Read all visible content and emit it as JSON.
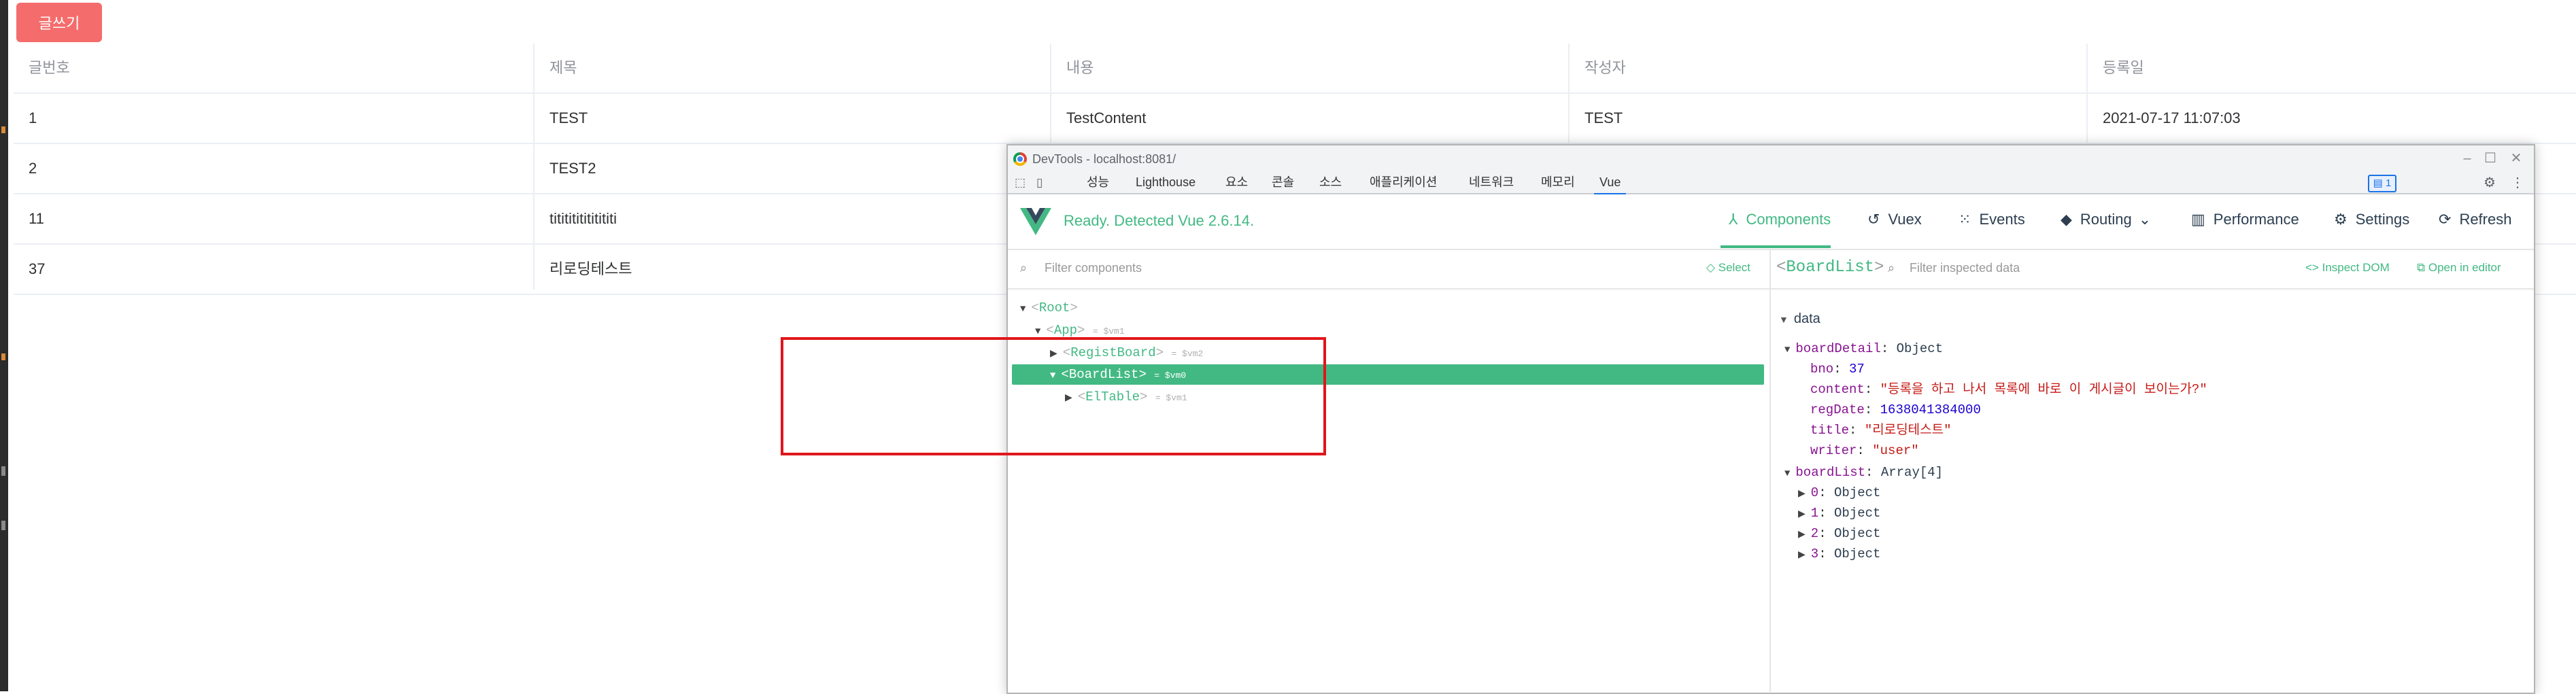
{
  "page": {
    "write_button": "글쓰기",
    "table": {
      "headers": [
        "글번호",
        "제목",
        "내용",
        "작성자",
        "등록일"
      ],
      "rows": [
        [
          "1",
          "TEST",
          "TestContent",
          "TEST",
          "2021-07-17 11:07:03"
        ],
        [
          "2",
          "TEST2",
          "",
          "",
          ""
        ],
        [
          "11",
          "tititititititititi",
          "",
          "",
          ""
        ],
        [
          "37",
          "리로딩테스트",
          "",
          "",
          ""
        ]
      ]
    }
  },
  "devtools": {
    "window_title": "DevTools - localhost:8081/",
    "tabs": [
      "성능",
      "Lighthouse",
      "요소",
      "콘솔",
      "소스",
      "애플리케이션",
      "네트워크",
      "메모리",
      "Vue"
    ],
    "active_tab": "Vue",
    "issues_badge": "1",
    "vue": {
      "status": "Ready. Detected Vue 2.6.14.",
      "nav": {
        "components": "Components",
        "vuex": "Vuex",
        "events": "Events",
        "routing": "Routing",
        "performance": "Performance",
        "settings": "Settings",
        "refresh": "Refresh"
      },
      "filter_components_placeholder": "Filter components",
      "select_label": "Select",
      "tree": [
        {
          "name": "Root",
          "vm": ""
        },
        {
          "name": "App",
          "vm": "= $vm1"
        },
        {
          "name": "RegistBoard",
          "vm": "= $vm2"
        },
        {
          "name": "BoardList",
          "vm": "= $vm0"
        },
        {
          "name": "ElTable",
          "vm": "= $vm1"
        }
      ],
      "inspector": {
        "component": "BoardList",
        "filter_placeholder": "Filter inspected data",
        "inspect_dom": "Inspect DOM",
        "open_in_editor": "Open in editor",
        "section": "data",
        "boardDetail": {
          "key": "boardDetail",
          "type": "Object",
          "fields": [
            {
              "key": "bno",
              "value": "37",
              "kind": "num"
            },
            {
              "key": "content",
              "value": "\"등록을 하고 나서 목록에 바로 이 게시글이 보이는가?\"",
              "kind": "str"
            },
            {
              "key": "regDate",
              "value": "1638041384000",
              "kind": "num"
            },
            {
              "key": "title",
              "value": "\"리로딩테스트\"",
              "kind": "str"
            },
            {
              "key": "writer",
              "value": "\"user\"",
              "kind": "str"
            }
          ]
        },
        "boardList": {
          "key": "boardList",
          "type": "Array[4]",
          "items": [
            "0",
            "1",
            "2",
            "3"
          ],
          "item_type": "Object"
        }
      }
    }
  }
}
